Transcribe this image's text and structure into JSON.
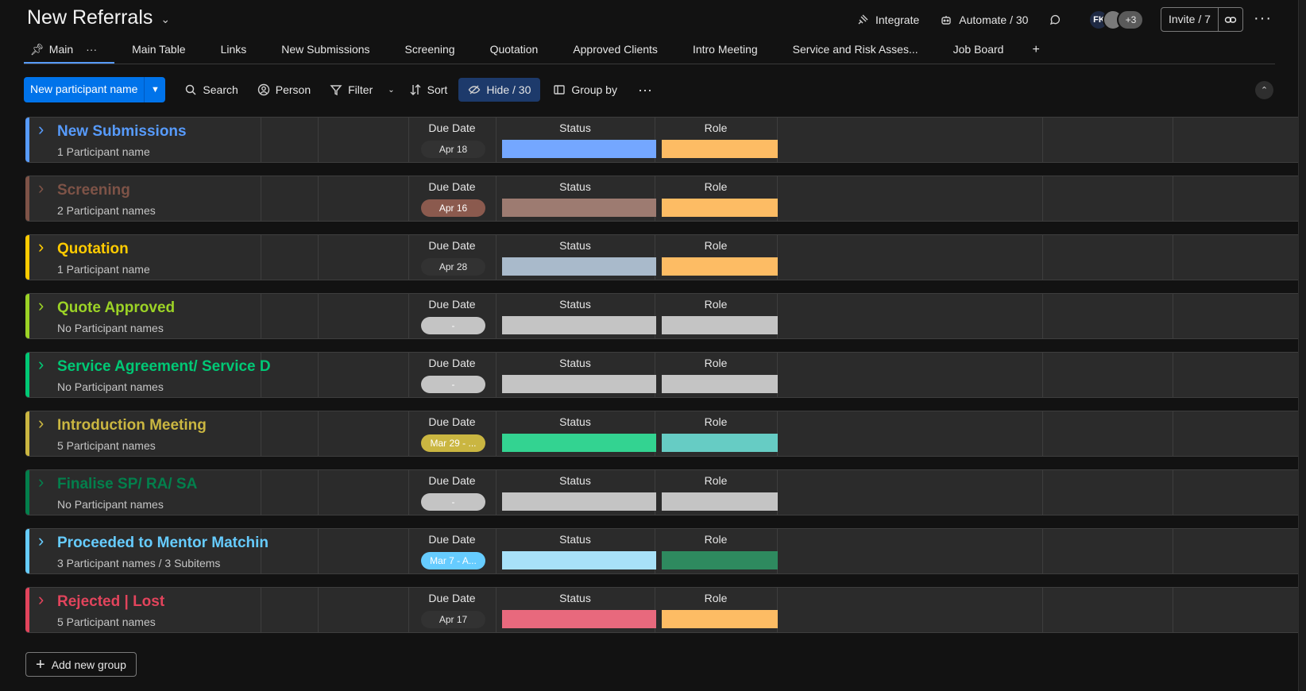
{
  "board": {
    "title": "New Referrals"
  },
  "header": {
    "integrate": "Integrate",
    "automate": "Automate / 30",
    "avatar_initials": "FK",
    "avatar_more": "+3",
    "invite": "Invite / 7"
  },
  "tabs": [
    {
      "label": "Main"
    },
    {
      "label": "Main Table"
    },
    {
      "label": "Links"
    },
    {
      "label": "New Submissions"
    },
    {
      "label": "Screening"
    },
    {
      "label": "Quotation"
    },
    {
      "label": "Approved Clients"
    },
    {
      "label": "Intro Meeting"
    },
    {
      "label": "Service and Risk Asses..."
    },
    {
      "label": "Job Board"
    }
  ],
  "toolbar": {
    "new_item": "New participant name",
    "search": "Search",
    "person": "Person",
    "filter": "Filter",
    "sort": "Sort",
    "hide": "Hide / 30",
    "group_by": "Group by"
  },
  "columns": {
    "due": "Due Date",
    "status": "Status",
    "role": "Role"
  },
  "groups": [
    {
      "name": "New Submissions",
      "count": "1 Participant name",
      "color": "#579bfc",
      "due": "Apr 18",
      "due_bg": "#323232",
      "due_fg": "#e6e6e6",
      "status_color": "#74a7ff",
      "role_color": "#fdbc64"
    },
    {
      "name": "Screening",
      "count": "2 Participant names",
      "color": "#7e5347",
      "due": "Apr 16",
      "due_bg": "#8b5a4e",
      "due_fg": "#ffffff",
      "status_color": "#9d7b71",
      "role_color": "#fdbc64"
    },
    {
      "name": "Quotation",
      "count": "1 Participant name",
      "color": "#ffcb00",
      "due": "Apr 28",
      "due_bg": "#323232",
      "due_fg": "#e6e6e6",
      "status_color": "#a9bacb",
      "role_color": "#fdbc64"
    },
    {
      "name": "Quote Approved",
      "count": "No Participant names",
      "color": "#9cd326",
      "due": "-",
      "due_bg": "#c4c4c4",
      "due_fg": "#ffffff",
      "status_color": "#c4c4c4",
      "role_color": "#c4c4c4"
    },
    {
      "name": "Service Agreement/ Service D",
      "count": "No Participant names",
      "color": "#00c875",
      "due": "-",
      "due_bg": "#c4c4c4",
      "due_fg": "#ffffff",
      "status_color": "#c4c4c4",
      "role_color": "#c4c4c4"
    },
    {
      "name": "Introduction Meeting",
      "count": "5 Participant names",
      "color": "#cab641",
      "due": "Mar 29 - ...",
      "due_bg": "#cab641",
      "due_fg": "#ffffff",
      "status_color": "#33d391",
      "role_color": "#66ccc4"
    },
    {
      "name": "Finalise SP/ RA/ SA",
      "count": "No Participant names",
      "color": "#037f4c",
      "due": "-",
      "due_bg": "#c4c4c4",
      "due_fg": "#ffffff",
      "status_color": "#c4c4c4",
      "role_color": "#c4c4c4"
    },
    {
      "name": "Proceeded to Mentor Matchin",
      "count": "3 Participant names / 3 Subitems",
      "color": "#66ccff",
      "due": "Mar 7 - A...",
      "due_bg": "#66ccff",
      "due_fg": "#ffffff",
      "status_color": "#a8e1f8",
      "role_color": "#2e8a5f"
    },
    {
      "name": "Rejected | Lost",
      "count": "5 Participant names",
      "color": "#e2445c",
      "due": "Apr 17",
      "due_bg": "#323232",
      "due_fg": "#e6e6e6",
      "status_color": "#e8697d",
      "role_color": "#fdbc64"
    }
  ],
  "add_group": "Add new group"
}
